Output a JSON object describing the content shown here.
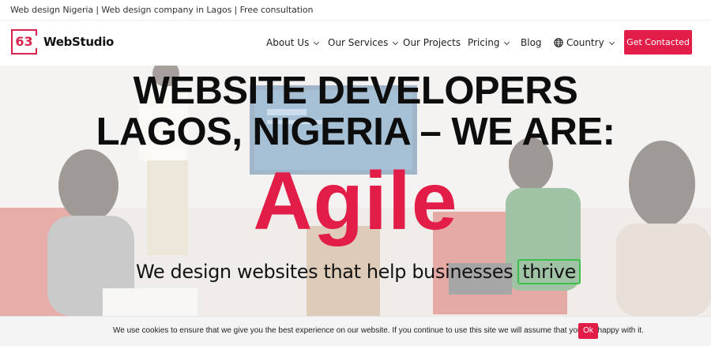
{
  "topbar": {
    "text": "Web design Nigeria | Web design company in Lagos | Free consultation"
  },
  "header": {
    "logo_mark": "63",
    "logo_text": "WebStudio",
    "nav": [
      {
        "label": "About Us",
        "has_dropdown": true
      },
      {
        "label": "Our Services",
        "has_dropdown": true
      },
      {
        "label": "Our Projects",
        "has_dropdown": false
      },
      {
        "label": "Pricing",
        "has_dropdown": true
      },
      {
        "label": "Blog",
        "has_dropdown": false
      },
      {
        "label": "Country",
        "has_dropdown": true,
        "icon": "globe-icon"
      }
    ],
    "cta_label": "Get Contacted"
  },
  "hero": {
    "headline_line1": "WEBSITE DEVELOPERS",
    "headline_line2": "LAGOS, NIGERIA – WE ARE:",
    "rotating_word": "Agile",
    "tagline_prefix": "We design websites that help businesses",
    "tagline_highlight": "thrive"
  },
  "cookie": {
    "text": "We use cookies to ensure that we give you the best experience on our website. If you continue to use this site we will assume that you are happy with it.",
    "ok_label": "Ok"
  },
  "colors": {
    "brand": "#e11d48",
    "highlight_box": "#3cc04a",
    "text": "#0d0d0d"
  }
}
